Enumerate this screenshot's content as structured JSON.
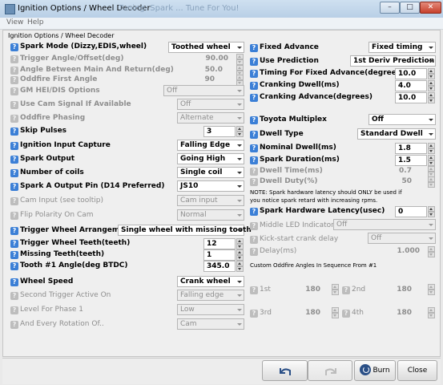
{
  "window": {
    "title": "Ignition Options / Wheel Decoder",
    "ghost_title": "Tuning: Spark ... Tune For You!"
  },
  "menu": [
    "View",
    "Help"
  ],
  "panel_title": "Ignition Options / Wheel Decoder",
  "help_glyph": "?",
  "left": {
    "spark_mode": {
      "label": "Spark Mode (Dizzy,EDIS,wheel)",
      "value": "Toothed wheel"
    },
    "trigger_angle": {
      "label": "Trigger Angle/Offset(deg)",
      "value": "90.00"
    },
    "angle_between": {
      "label": "Angle Between Main And Return(deg)",
      "value": "50.0"
    },
    "oddfire_first": {
      "label": "Oddfire First Angle",
      "value": "90"
    },
    "gm_hei": {
      "label": "GM HEI/DIS Options",
      "value": "Off"
    },
    "use_cam": {
      "label": "Use Cam Signal If Available",
      "value": "Off"
    },
    "oddfire_phasing": {
      "label": "Oddfire Phasing",
      "value": "Alternate"
    },
    "skip_pulses": {
      "label": "Skip Pulses",
      "value": "3"
    },
    "ignition_input": {
      "label": "Ignition Input Capture",
      "value": "Falling Edge"
    },
    "spark_output": {
      "label": "Spark Output",
      "value": "Going High"
    },
    "num_coils": {
      "label": "Number of coils",
      "value": "Single coil"
    },
    "spark_a_output": {
      "label": "Spark A Output Pin (D14 Preferred)",
      "value": "JS10"
    },
    "cam_input": {
      "label": "Cam Input (see tooltip)",
      "value": "Cam input"
    },
    "flip_polarity": {
      "label": "Flip Polarity On Cam",
      "value": "Normal"
    },
    "trigger_arrangement": {
      "label": "Trigger Wheel Arrangement",
      "value": "Single wheel with missing tooth"
    },
    "trigger_teeth": {
      "label": "Trigger Wheel Teeth(teeth)",
      "value": "12"
    },
    "missing_teeth": {
      "label": "Missing Teeth(teeth)",
      "value": "1"
    },
    "tooth1_angle": {
      "label": "Tooth #1 Angle(deg BTDC)",
      "value": "345.0"
    },
    "wheel_speed": {
      "label": "Wheel Speed",
      "value": "Crank wheel"
    },
    "second_trigger": {
      "label": "Second Trigger Active On",
      "value": "Falling edge"
    },
    "level_phase": {
      "label": "Level For Phase 1",
      "value": "Low"
    },
    "every_rotation": {
      "label": "And Every Rotation Of..",
      "value": "Cam"
    }
  },
  "right": {
    "fixed_advance": {
      "label": "Fixed Advance",
      "value": "Fixed timing"
    },
    "use_prediction": {
      "label": "Use Prediction",
      "value": "1st Deriv Prediction"
    },
    "timing_fixed": {
      "label": "Timing For Fixed Advance(degrees)",
      "value": "10.0"
    },
    "cranking_dwell": {
      "label": "Cranking Dwell(ms)",
      "value": "4.0"
    },
    "cranking_advance": {
      "label": "Cranking Advance(degrees)",
      "value": "10.0"
    },
    "toyota_multiplex": {
      "label": "Toyota Multiplex",
      "value": "Off"
    },
    "dwell_type": {
      "label": "Dwell Type",
      "value": "Standard Dwell"
    },
    "nominal_dwell": {
      "label": "Nominal Dwell(ms)",
      "value": "1.8"
    },
    "spark_duration": {
      "label": "Spark Duration(ms)",
      "value": "1.5"
    },
    "dwell_time": {
      "label": "Dwell Time(ms)",
      "value": "0.7"
    },
    "dwell_duty": {
      "label": "Dwell Duty(%)",
      "value": "50"
    },
    "note_line1": "NOTE: Spark hardware latency should ONLY be used if",
    "note_line2": "you notice spark retard with increasing rpms.",
    "spark_latency": {
      "label": "Spark Hardware Latency(usec)",
      "value": "0"
    },
    "middle_led": {
      "label": "Middle LED Indicator",
      "value": "Off"
    },
    "kickstart": {
      "label": "Kick-start crank delay",
      "value": "Off"
    },
    "delay": {
      "label": "Delay(ms)",
      "value": "1.000"
    },
    "custom_heading": "Custom Oddfire Angles In Sequence From #1",
    "angle_1st": {
      "label": "1st",
      "value": "180"
    },
    "angle_2nd": {
      "label": "2nd",
      "value": "180"
    },
    "angle_3rd": {
      "label": "3rd",
      "value": "180"
    },
    "angle_4th": {
      "label": "4th",
      "value": "180"
    }
  },
  "footer": {
    "burn": "Burn",
    "close": "Close"
  },
  "colors": {
    "help_blue": "#3b7fd6",
    "disabled_text": "#8e8e8e",
    "burn_icon": "#2a4f86"
  }
}
